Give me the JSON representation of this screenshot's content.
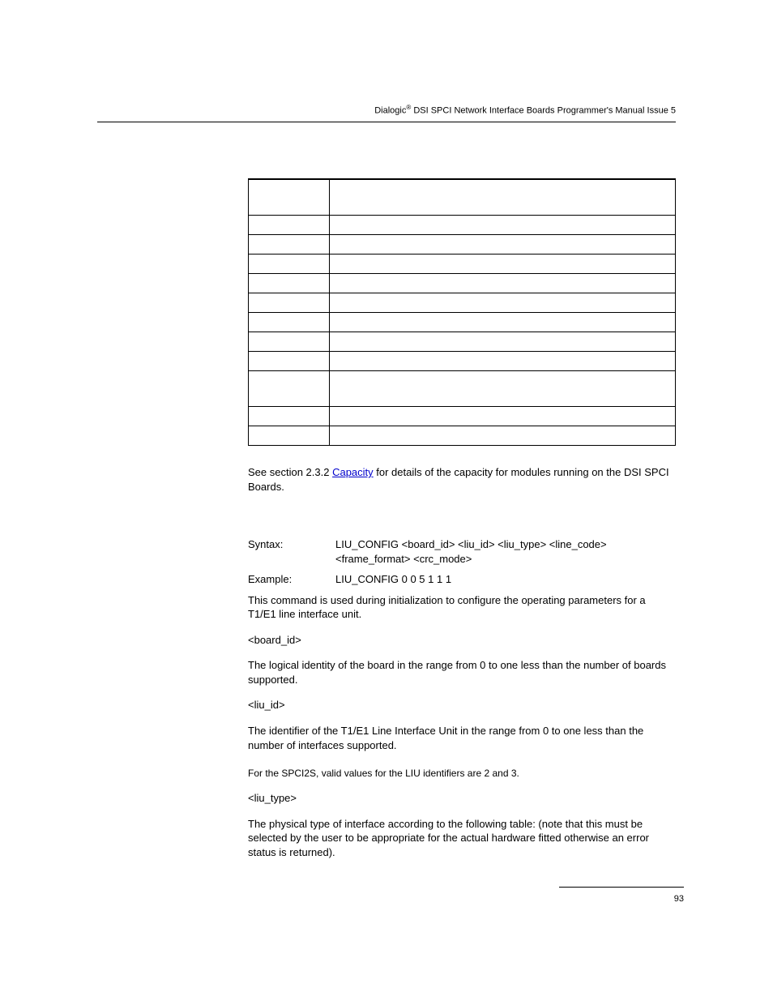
{
  "header": {
    "brand": "Dialogic",
    "reg": "®",
    "rest": " DSI SPCI Network Interface Boards Programmer's Manual Issue 5"
  },
  "see_section": {
    "prefix": "See section 2.3.2 ",
    "link": "Capacity",
    "suffix": " for details of the capacity for modules running on the DSI SPCI Boards."
  },
  "syntax": {
    "label": "Syntax:",
    "value": "LIU_CONFIG <board_id> <liu_id> <liu_type> <line_code> <frame_format> <crc_mode>"
  },
  "example": {
    "label": "Example:",
    "value": "LIU_CONFIG 0 0 5 1 1 1"
  },
  "p1": "This command is used during initialization to configure the operating parameters for a T1/E1 line interface unit.",
  "board_id_tag": "<board_id>",
  "p2": "The logical identity of the board in the range from 0 to one less than the number of boards supported.",
  "liu_id_tag": "<liu_id>",
  "p3": "The identifier of the T1/E1 Line Interface Unit in the range from 0 to one less than the number of interfaces supported.",
  "note": "For the SPCI2S, valid values for the LIU identifiers are 2 and 3.",
  "liu_type_tag": "<liu_type>",
  "p4": "The physical type of interface according to the following table: (note that this must be selected by the user to be appropriate for the actual hardware fitted otherwise an error status is returned).",
  "page_number": "93"
}
